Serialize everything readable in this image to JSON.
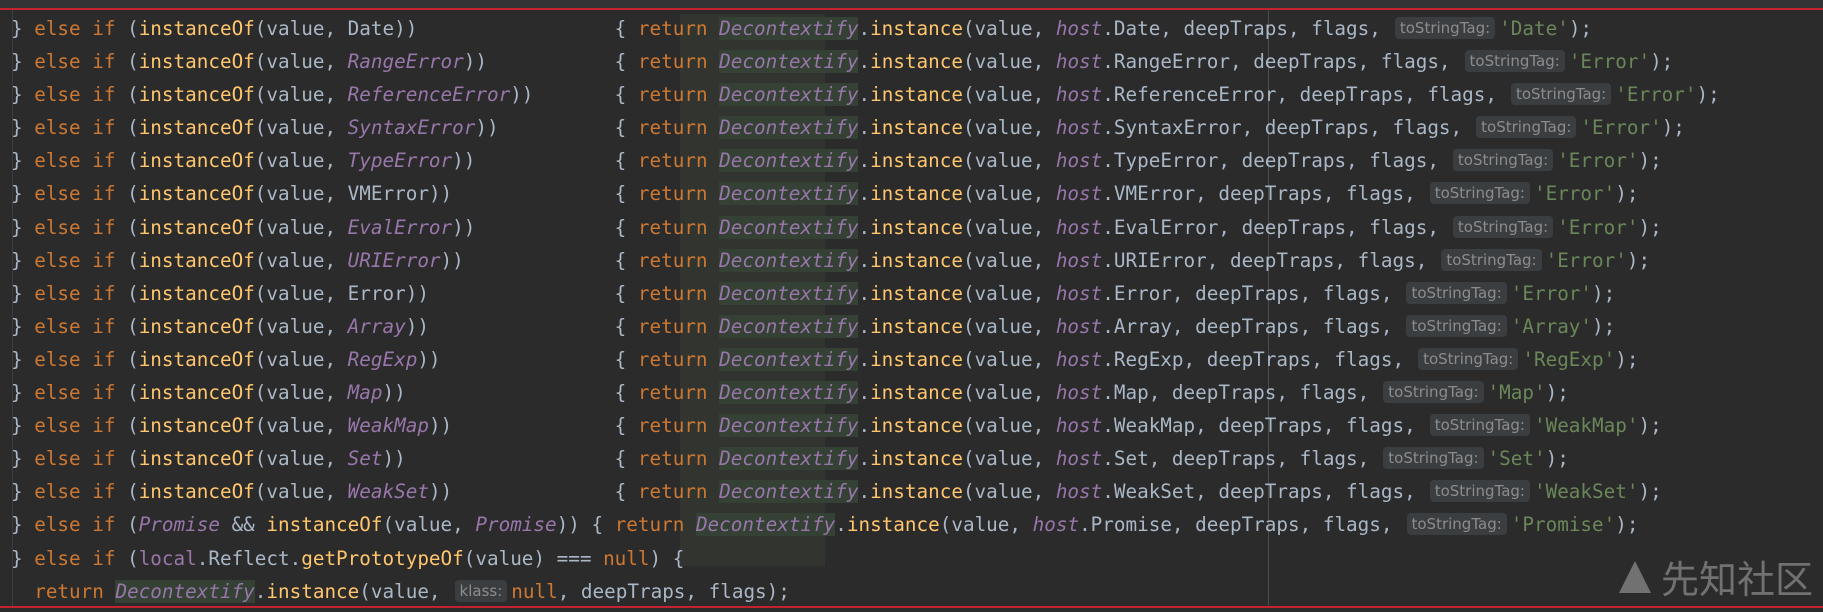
{
  "editor": {
    "lines": [
      {
        "id": "l1",
        "type": "std",
        "cond": "Date",
        "cond_italic": false,
        "host": "Date",
        "tag": "'Date'"
      },
      {
        "id": "l2",
        "type": "std",
        "cond": "RangeError",
        "cond_italic": true,
        "host": "RangeError",
        "tag": "'Error'"
      },
      {
        "id": "l3",
        "type": "std",
        "cond": "ReferenceError",
        "cond_italic": true,
        "host": "ReferenceError",
        "tag": "'Error'"
      },
      {
        "id": "l4",
        "type": "std",
        "cond": "SyntaxError",
        "cond_italic": true,
        "host": "SyntaxError",
        "tag": "'Error'"
      },
      {
        "id": "l5",
        "type": "std",
        "cond": "TypeError",
        "cond_italic": true,
        "host": "TypeError",
        "tag": "'Error'"
      },
      {
        "id": "l6",
        "type": "std",
        "cond": "VMError",
        "cond_italic": false,
        "host": "VMError",
        "tag": "'Error'"
      },
      {
        "id": "l7",
        "type": "std",
        "cond": "EvalError",
        "cond_italic": true,
        "host": "EvalError",
        "tag": "'Error'"
      },
      {
        "id": "l8",
        "type": "std",
        "cond": "URIError",
        "cond_italic": true,
        "host": "URIError",
        "tag": "'Error'"
      },
      {
        "id": "l9",
        "type": "std",
        "cond": "Error",
        "cond_italic": false,
        "host": "Error",
        "tag": "'Error'"
      },
      {
        "id": "l10",
        "type": "std",
        "cond": "Array",
        "cond_italic": true,
        "host": "Array",
        "tag": "'Array'"
      },
      {
        "id": "l11",
        "type": "std",
        "cond": "RegExp",
        "cond_italic": true,
        "host": "RegExp",
        "tag": "'RegExp'"
      },
      {
        "id": "l12",
        "type": "std",
        "cond": "Map",
        "cond_italic": true,
        "host": "Map",
        "tag": "'Map'"
      },
      {
        "id": "l13",
        "type": "std",
        "cond": "WeakMap",
        "cond_italic": true,
        "host": "WeakMap",
        "tag": "'WeakMap'"
      },
      {
        "id": "l14",
        "type": "std",
        "cond": "Set",
        "cond_italic": true,
        "host": "Set",
        "tag": "'Set'"
      },
      {
        "id": "l15",
        "type": "std",
        "cond": "WeakSet",
        "cond_italic": true,
        "host": "WeakSet",
        "tag": "'WeakSet'"
      },
      {
        "id": "l16",
        "type": "promise",
        "cond": "Promise",
        "host": "Promise",
        "tag": "'Promise'"
      },
      {
        "id": "l17",
        "type": "reflect"
      },
      {
        "id": "l18",
        "type": "klass"
      }
    ],
    "tokens": {
      "brace_close": "} ",
      "else_if": "else if",
      "instanceOf": "instanceOf",
      "value": "value",
      "return": "return",
      "decontextify": "Decontextify",
      "instance": "instance",
      "host": "host",
      "deepTraps": "deepTraps",
      "flags": "flags",
      "hint_toStringTag": "toStringTag:",
      "hint_klass": "klass:",
      "promise": "Promise",
      "and": "&&",
      "local": "local",
      "reflect": "Reflect",
      "getPrototypeOf": "getPrototypeOf",
      "strict_eq": "===",
      "null": "null"
    }
  },
  "watermark": {
    "text": "先知社区"
  }
}
